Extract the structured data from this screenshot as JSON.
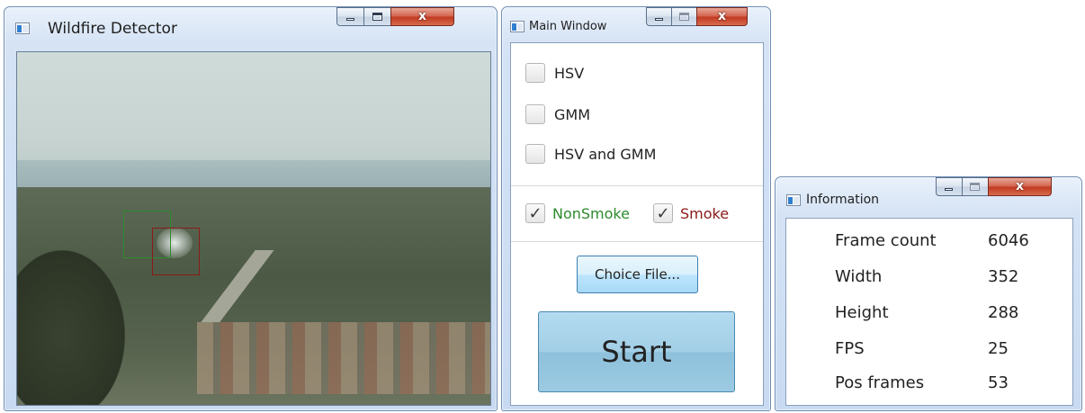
{
  "detector_window": {
    "title": "Wildfire Detector",
    "box_colors": {
      "nonsmoke": "#2e8b2e",
      "smoke": "#8b1a1a"
    }
  },
  "main_window": {
    "title": "Main Window",
    "methods": [
      {
        "label": "HSV",
        "checked": false
      },
      {
        "label": "GMM",
        "checked": false
      },
      {
        "label": "HSV and GMM",
        "checked": false
      }
    ],
    "filters": [
      {
        "label": "NonSmoke",
        "checked": true,
        "color": "#2e8b2e"
      },
      {
        "label": "Smoke",
        "checked": true,
        "color": "#8b1a1a"
      }
    ],
    "choice_file_label": "Choice File...",
    "start_label": "Start",
    "check_glyph": "✓"
  },
  "info_window": {
    "title": "Information",
    "rows": [
      {
        "label": "Frame count",
        "value": "6046"
      },
      {
        "label": "Width",
        "value": "352"
      },
      {
        "label": "Height",
        "value": "288"
      },
      {
        "label": "FPS",
        "value": "25"
      },
      {
        "label": "Pos frames",
        "value": "53"
      }
    ]
  },
  "caption": {
    "close_glyph": "x"
  }
}
